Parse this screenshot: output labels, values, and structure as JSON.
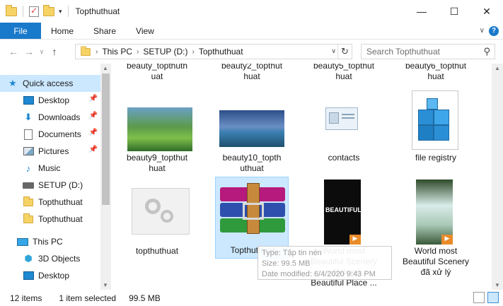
{
  "window": {
    "title": "Topthuthuat",
    "minimize": "—",
    "maximize": "☐",
    "close": "✕"
  },
  "ribbon": {
    "file": "File",
    "tabs": [
      "Home",
      "Share",
      "View"
    ],
    "expand": "∨",
    "help": "?"
  },
  "nav_buttons": {
    "back": "←",
    "forward": "→",
    "recent": "∨",
    "up": "↑"
  },
  "address": {
    "crumbs": [
      "This PC",
      "SETUP (D:)",
      "Topthuthuat"
    ],
    "separator": "›",
    "dropdown": "∨",
    "refresh": "↻"
  },
  "search": {
    "placeholder": "Search Topthuthuat",
    "icon": "⚲"
  },
  "navpane": {
    "items": [
      {
        "label": "Quick access",
        "icon": "star-icon",
        "glyph": "★",
        "pinned": false
      },
      {
        "label": "Desktop",
        "icon": "desktop-icon",
        "glyph": "",
        "pinned": true
      },
      {
        "label": "Downloads",
        "icon": "download-icon",
        "glyph": "⬇",
        "pinned": true
      },
      {
        "label": "Documents",
        "icon": "documents-icon",
        "glyph": "",
        "pinned": true
      },
      {
        "label": "Pictures",
        "icon": "pictures-icon",
        "glyph": "",
        "pinned": true
      },
      {
        "label": "Music",
        "icon": "music-icon",
        "glyph": "♪",
        "pinned": false
      },
      {
        "label": "SETUP (D:)",
        "icon": "drive-icon",
        "glyph": "",
        "pinned": false
      },
      {
        "label": "Topthuthuat",
        "icon": "folder-icon",
        "glyph": "",
        "pinned": false
      },
      {
        "label": "Topthuthuat",
        "icon": "folder-icon",
        "glyph": "",
        "pinned": false
      },
      {
        "label": "This PC",
        "icon": "computer-icon",
        "glyph": "",
        "pinned": false
      },
      {
        "label": "3D Objects",
        "icon": "cube-icon",
        "glyph": "⬢",
        "pinned": false
      },
      {
        "label": "Desktop",
        "icon": "desktop-icon",
        "glyph": "",
        "pinned": false
      }
    ],
    "pin_glyph": "📌"
  },
  "files": {
    "row0": [
      {
        "label": "beauty_topthuth\nuat"
      },
      {
        "label": "beauty2_topthut\nhuat"
      },
      {
        "label": "beauty5_topthut\nhuat"
      },
      {
        "label": "beauty6_topthut\nhuat"
      }
    ],
    "row1": [
      {
        "label": "beauty9_topthut\nhuat"
      },
      {
        "label": "beauty10_topth\nuthuat"
      },
      {
        "label": "contacts"
      },
      {
        "label": "file registry"
      }
    ],
    "row2": [
      {
        "label": "topthuthuat"
      },
      {
        "label": "Topthuthuat"
      },
      {
        "label": "World most\nBeautiful Scenery\n- Natural\nBeautiful Place ..."
      },
      {
        "label": "World most\nBeautiful Scenery\nđã xử lý"
      }
    ],
    "video_thumb_text": "BEAUTIFUL"
  },
  "tooltip": {
    "line1": "Type: Tập tin nén",
    "line2": "Size: 99.5 MB",
    "line3": "Date modified: 6/4/2020 9:43 PM"
  },
  "status": {
    "items": "12 items",
    "selected": "1 item selected",
    "size": "99.5 MB"
  }
}
